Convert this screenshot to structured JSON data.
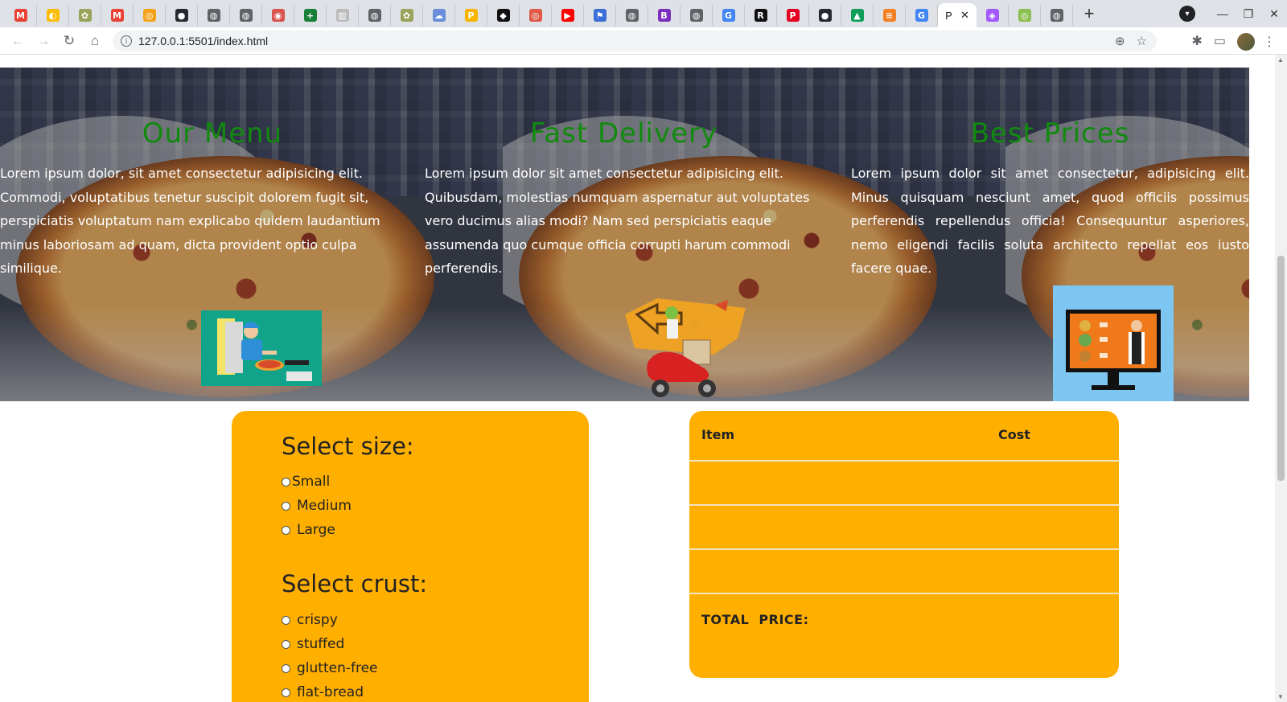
{
  "browser": {
    "tabs": [
      {
        "icon": "gmail-icon",
        "letter": "M",
        "color": "#ea4335"
      },
      {
        "icon": "google-photos-icon",
        "letter": "◐",
        "color": "#fbbc05"
      },
      {
        "icon": "plant-icon",
        "letter": "✿",
        "color": "#9aa35a"
      },
      {
        "icon": "gmail-icon",
        "letter": "M",
        "color": "#ea4335"
      },
      {
        "icon": "app-icon",
        "letter": "◎",
        "color": "#f4a21b"
      },
      {
        "icon": "github-icon",
        "letter": "●",
        "color": "#24292f"
      },
      {
        "icon": "globe-icon",
        "letter": "◍",
        "color": "#5f6368"
      },
      {
        "icon": "globe-icon",
        "letter": "◍",
        "color": "#5f6368"
      },
      {
        "icon": "app-icon",
        "letter": "◉",
        "color": "#d9534f"
      },
      {
        "icon": "sheets-icon",
        "letter": "+",
        "color": "#188038"
      },
      {
        "icon": "doc-icon",
        "letter": "▥",
        "color": "#bbbbbb"
      },
      {
        "icon": "globe-icon",
        "letter": "◍",
        "color": "#5f6368"
      },
      {
        "icon": "plant-icon",
        "letter": "✿",
        "color": "#9aa35a"
      },
      {
        "icon": "cloud-icon",
        "letter": "☁",
        "color": "#6a8edb"
      },
      {
        "icon": "p-icon",
        "letter": "P",
        "color": "#f7b500"
      },
      {
        "icon": "app-icon",
        "letter": "◆",
        "color": "#111111"
      },
      {
        "icon": "app-icon",
        "letter": "◎",
        "color": "#e05a47"
      },
      {
        "icon": "youtube-icon",
        "letter": "▶",
        "color": "#ff0000"
      },
      {
        "icon": "flag-icon",
        "letter": "⚑",
        "color": "#3b6fd8"
      },
      {
        "icon": "globe-icon",
        "letter": "◍",
        "color": "#5f6368"
      },
      {
        "icon": "b-icon",
        "letter": "B",
        "color": "#7b2fbe"
      },
      {
        "icon": "globe-icon",
        "letter": "◍",
        "color": "#5f6368"
      },
      {
        "icon": "google-icon",
        "letter": "G",
        "color": "#4285f4"
      },
      {
        "icon": "r-icon",
        "letter": "R",
        "color": "#111111"
      },
      {
        "icon": "pinterest-icon",
        "letter": "P",
        "color": "#e60023"
      },
      {
        "icon": "github-icon",
        "letter": "●",
        "color": "#24292f"
      },
      {
        "icon": "drive-icon",
        "letter": "▲",
        "color": "#0f9d58"
      },
      {
        "icon": "stack-icon",
        "letter": "≡",
        "color": "#f48024"
      },
      {
        "icon": "google-icon",
        "letter": "G",
        "color": "#4285f4"
      }
    ],
    "active_tab_label": "P",
    "after_tabs": [
      {
        "icon": "figma-icon",
        "letter": "◈",
        "color": "#a259ff"
      },
      {
        "icon": "app-icon",
        "letter": "◎",
        "color": "#8bbf4f"
      },
      {
        "icon": "globe-icon",
        "letter": "◍",
        "color": "#5f6368"
      }
    ],
    "url": "127.0.0.1:5501/index.html"
  },
  "features": [
    {
      "title": "Our Menu",
      "text": "Lorem ipsum dolor, sit amet consectetur adipisicing elit. Commodi, voluptatibus tenetur suscipit dolorem fugit sit, perspiciatis voluptatum nam explicabo quidem laudantium minus laboriosam ad quam, dicta provident optio culpa similique.",
      "illustration": "online-order-illustration"
    },
    {
      "title": "Fast Delivery",
      "text": "Lorem ipsum dolor sit amet consectetur adipisicing elit. Quibusdam, molestias numquam aspernatur aut voluptates vero ducimus alias modi? Nam sed perspiciatis eaque assumenda quo cumque officia corrupti harum commodi perferendis.",
      "illustration": "delivery-scooter-illustration"
    },
    {
      "title": "Best Prices",
      "text": "Lorem ipsum dolor sit amet consectetur, adipisicing elit. Minus quisquam nesciunt amet, quod officiis possimus perferendis repellendus officia! Consequuntur asperiores, nemo eligendi facilis soluta architecto repellat eos iusto facere quae.",
      "illustration": "online-menu-screen-illustration"
    }
  ],
  "order_form": {
    "size_heading": "Select size:",
    "sizes": [
      "Small",
      "Medium",
      "Large"
    ],
    "crust_heading": "Select crust:",
    "crusts": [
      "crispy",
      "stuffed",
      "glutten-free",
      "flat-bread"
    ]
  },
  "summary": {
    "col_item": "Item",
    "col_cost": "Cost",
    "rows": [
      {
        "item": "",
        "cost": ""
      },
      {
        "item": "",
        "cost": ""
      },
      {
        "item": "",
        "cost": ""
      }
    ],
    "total_label": "TOTAL  PRICE:",
    "total_value": ""
  },
  "colors": {
    "panel": "#ffaf00",
    "feature_title": "#118a0f"
  }
}
